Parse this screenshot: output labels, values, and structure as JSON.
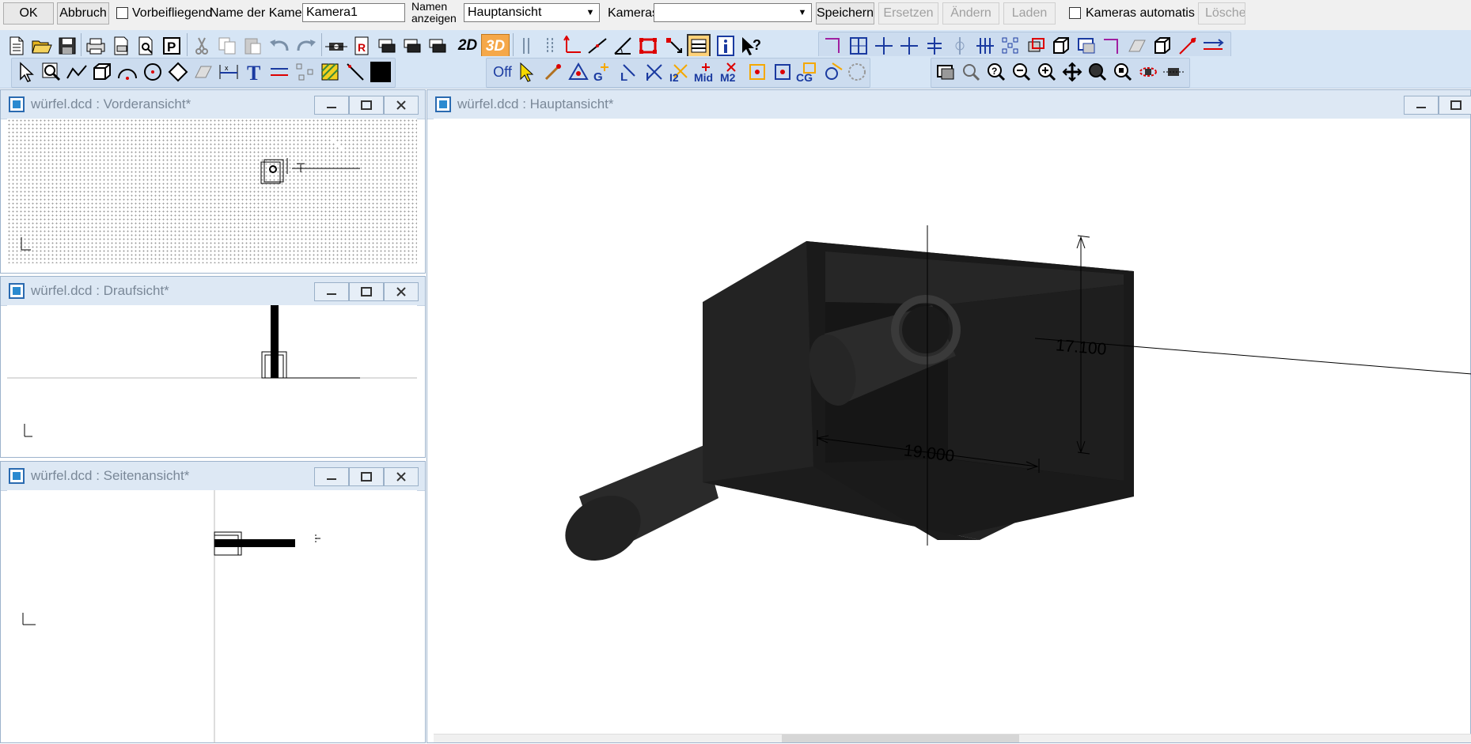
{
  "camera_bar": {
    "ok": "OK",
    "abbruch": "Abbruch",
    "vorbeifliegend": "Vorbeifliegend",
    "name_der_kamera": "Name der Kamera",
    "kamera_value": "Kamera1",
    "namen_line1": "Namen",
    "namen_line2": "anzeigen",
    "ansicht_value": "Hauptansicht",
    "kameras_label": "Kameras",
    "kameras_value": "",
    "speichern": "Speichern",
    "ersetzen": "Ersetzen",
    "aendern": "Ändern",
    "laden": "Laden",
    "auto_label": "Kameras automatisch la",
    "loeschen": "Löschen"
  },
  "toolbar": {
    "btn_2d": "2D",
    "btn_3d": "3D",
    "snap": [
      "Off",
      "G",
      "L",
      "I",
      "I2",
      "Mid",
      "M2",
      "CG"
    ]
  },
  "windows": {
    "front": {
      "title": "würfel.dcd : Vorderansicht*"
    },
    "top": {
      "title": "würfel.dcd : Draufsicht*"
    },
    "side": {
      "title": "würfel.dcd : Seitenansicht*"
    },
    "main": {
      "title": "würfel.dcd : Hauptansicht*"
    }
  },
  "dimensions": {
    "height": "17.100",
    "width": "19.000"
  },
  "colors": {
    "accent_3d": "#f5a84a",
    "toolbar_bg": "#d6e5f5",
    "model_dark": "#1e1e1e"
  }
}
